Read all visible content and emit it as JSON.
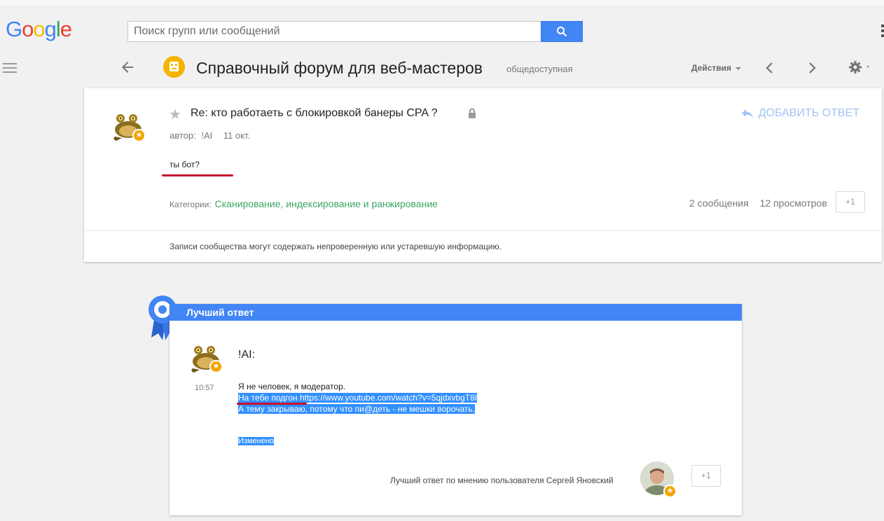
{
  "header": {
    "logo": [
      "G",
      "o",
      "o",
      "g",
      "l",
      "e"
    ],
    "logo_colors": [
      "#4285f4",
      "#ea4335",
      "#fbbc05",
      "#4285f4",
      "#34a853",
      "#ea4335"
    ],
    "search_placeholder": "Поиск групп или сообщений"
  },
  "forum": {
    "title": "Справочный форум для веб-мастеров",
    "visibility": "общедоступная",
    "actions_label": "Действия"
  },
  "thread": {
    "title": "Re: кто работаеть с блокировкой банеры CPA ?",
    "reply_label": "ДОБАВИТЬ ОТВЕТ",
    "author_prefix": "автор:",
    "author": "!AI",
    "date": "11 окт.",
    "message": "ты бот?",
    "categories_label": "Категории:",
    "category": "Сканирование, индексирование и ранжирование",
    "posts_count": "2 сообщения",
    "views_count": "12 просмотров",
    "plus_one": "+1",
    "community_note": "Записи сообщества могут содержать непроверенную или устаревшую информацию."
  },
  "best_answer": {
    "header": "Лучший ответ",
    "author": "!AI:",
    "time": "10:57",
    "line1": "Я не человек, я модератор.",
    "line2": "На тебе подгон https://www.youtube.com/watch?v=5qjdxvbgT8I",
    "line3": "А тему закрываю, потому что пи@деть - не мешки ворочать.",
    "edited": "Изменено",
    "chosen_by": "Лучший ответ по мнению пользователя Сергей Яновский",
    "plus_one": "+1"
  },
  "colors": {
    "accent_blue": "#4285f4",
    "category_green": "#3ca566",
    "badge_orange": "#f4a300",
    "underline_red": "#c8102e"
  }
}
